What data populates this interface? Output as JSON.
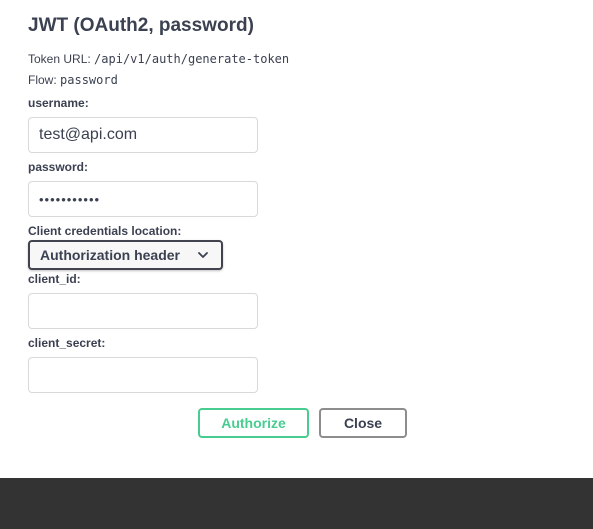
{
  "dialog": {
    "title": "JWT (OAuth2, password)",
    "token_url_label": "Token URL:",
    "token_url_value": "/api/v1/auth/generate-token",
    "flow_label": "Flow:",
    "flow_value": "password"
  },
  "form": {
    "username": {
      "label": "username:",
      "value": "test@api.com"
    },
    "password": {
      "label": "password:",
      "value": "•••••••••••"
    },
    "client_credentials_location": {
      "label": "Client credentials location:",
      "selected": "Authorization header"
    },
    "client_id": {
      "label": "client_id:",
      "value": ""
    },
    "client_secret": {
      "label": "client_secret:",
      "value": ""
    }
  },
  "actions": {
    "authorize_label": "Authorize",
    "close_label": "Close"
  },
  "colors": {
    "authorize_accent": "#49cc90",
    "text": "#3b4151",
    "footer_background": "#333333"
  }
}
